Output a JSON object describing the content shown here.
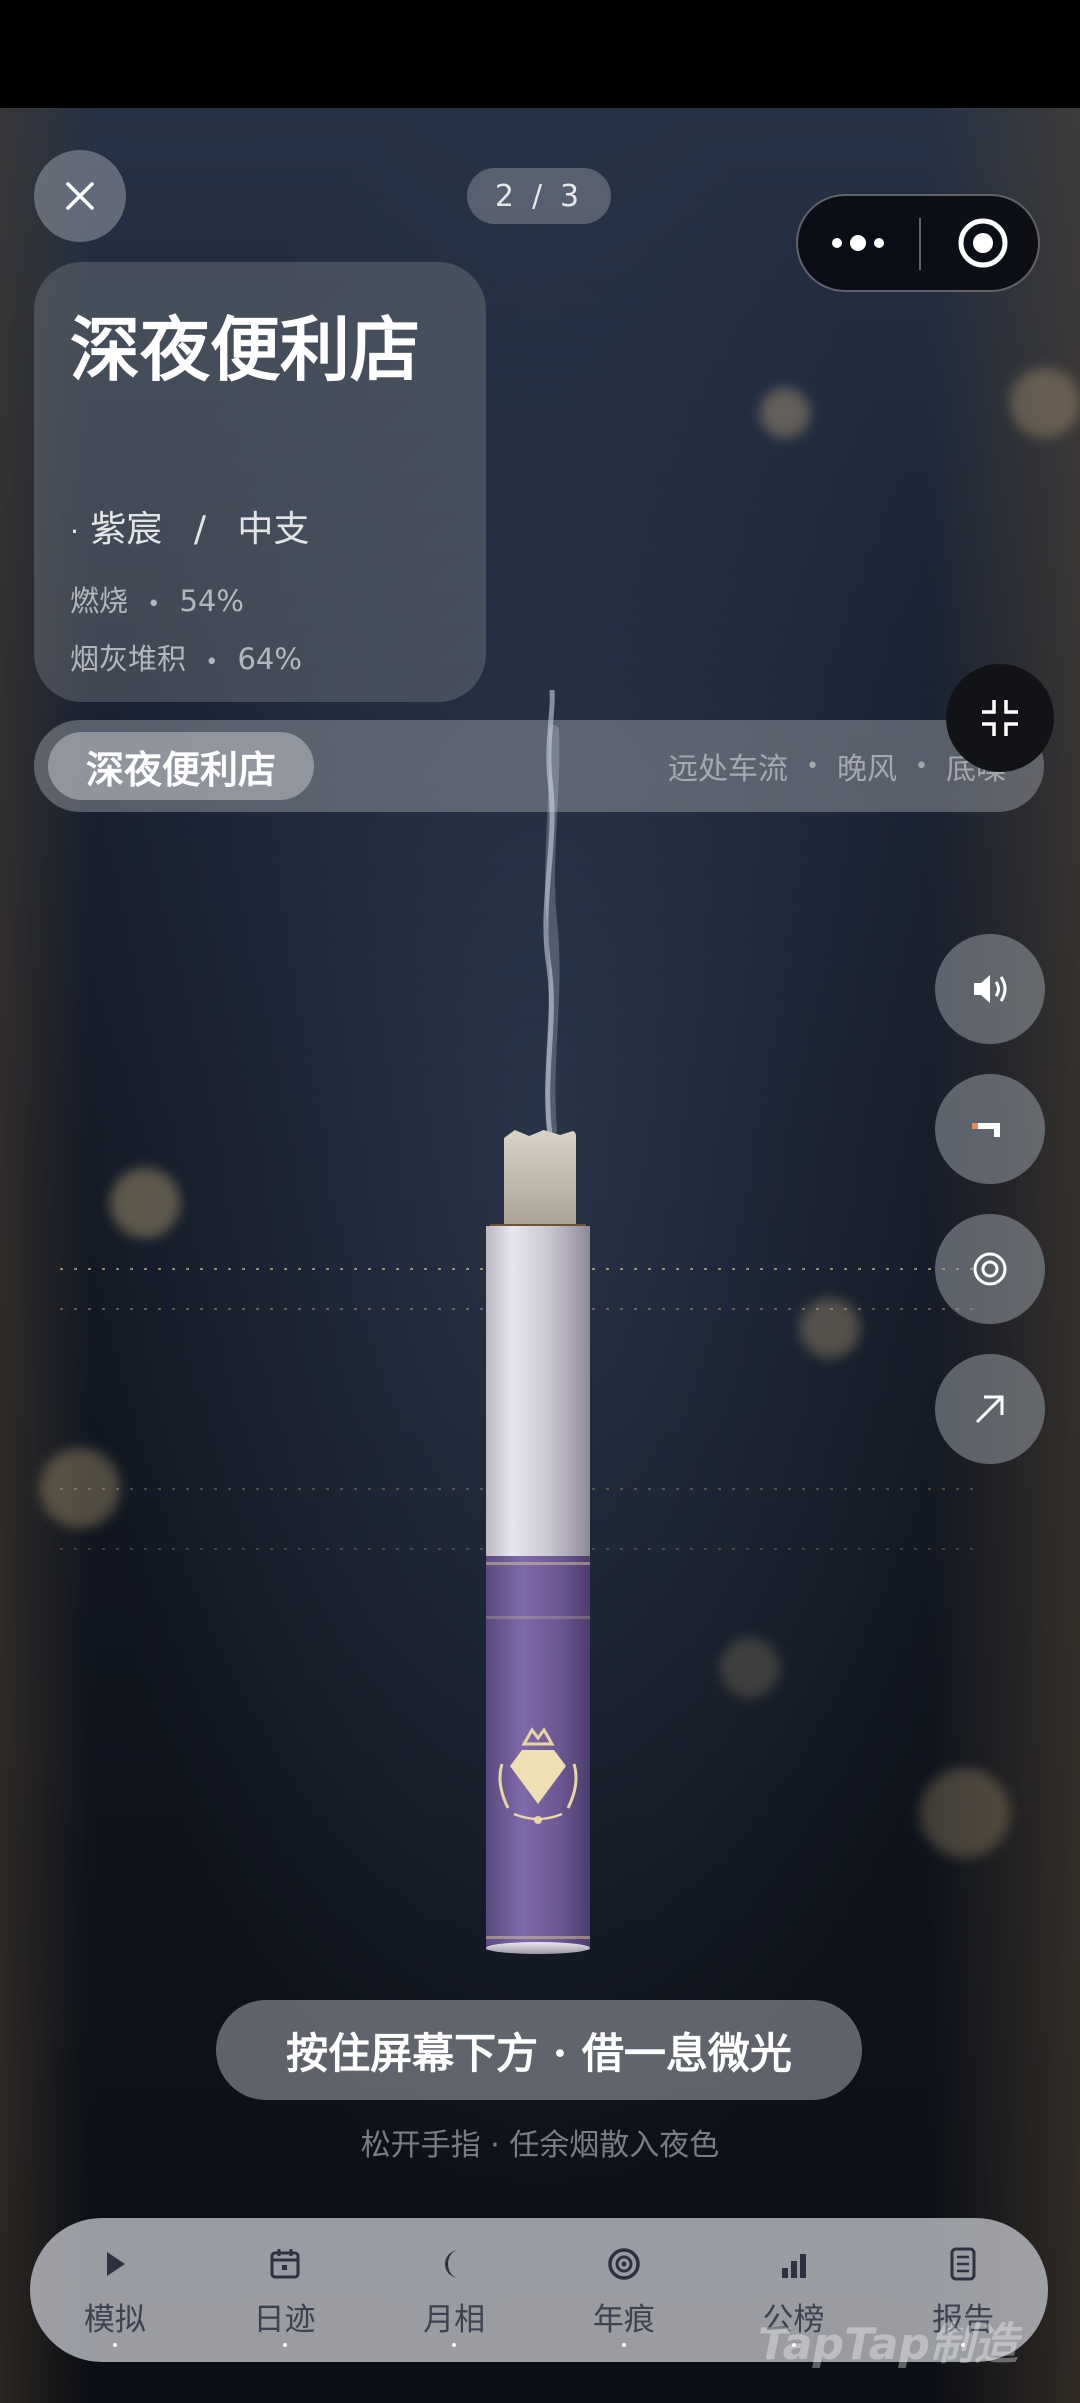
{
  "pager": {
    "current": "2",
    "total": "3",
    "separator": "/"
  },
  "card": {
    "title": "深夜便利店",
    "brand_bullet": "·",
    "brand": "紫宸",
    "brand_sep": "/",
    "spec": "中支",
    "burn_label": "燃烧",
    "burn_value": "54%",
    "ash_label": "烟灰堆积",
    "ash_value": "64%",
    "stat_dot": "•"
  },
  "scene_bar": {
    "active": "深夜便利店",
    "tags": [
      "远处车流",
      "晚风",
      "底噪"
    ],
    "tag_dot": "•"
  },
  "side_buttons": [
    "speaker-icon",
    "cigarette-icon",
    "target-icon",
    "arrow-up-right-icon"
  ],
  "cta": {
    "label": "按住屏幕下方 · 借一息微光",
    "hint": "松开手指 · 任余烟散入夜色"
  },
  "tabs": [
    {
      "label": "模拟",
      "icon": "play-icon"
    },
    {
      "label": "日迹",
      "icon": "calendar-icon"
    },
    {
      "label": "月相",
      "icon": "moon-icon"
    },
    {
      "label": "年痕",
      "icon": "ring-icon"
    },
    {
      "label": "公榜",
      "icon": "bars-icon"
    },
    {
      "label": "报告",
      "icon": "report-icon"
    }
  ],
  "watermark": "TapTap制造",
  "colors": {
    "filter": "#7f6aa8",
    "gold": "#e9d6a6",
    "tabbar": "#b9bcc2"
  }
}
